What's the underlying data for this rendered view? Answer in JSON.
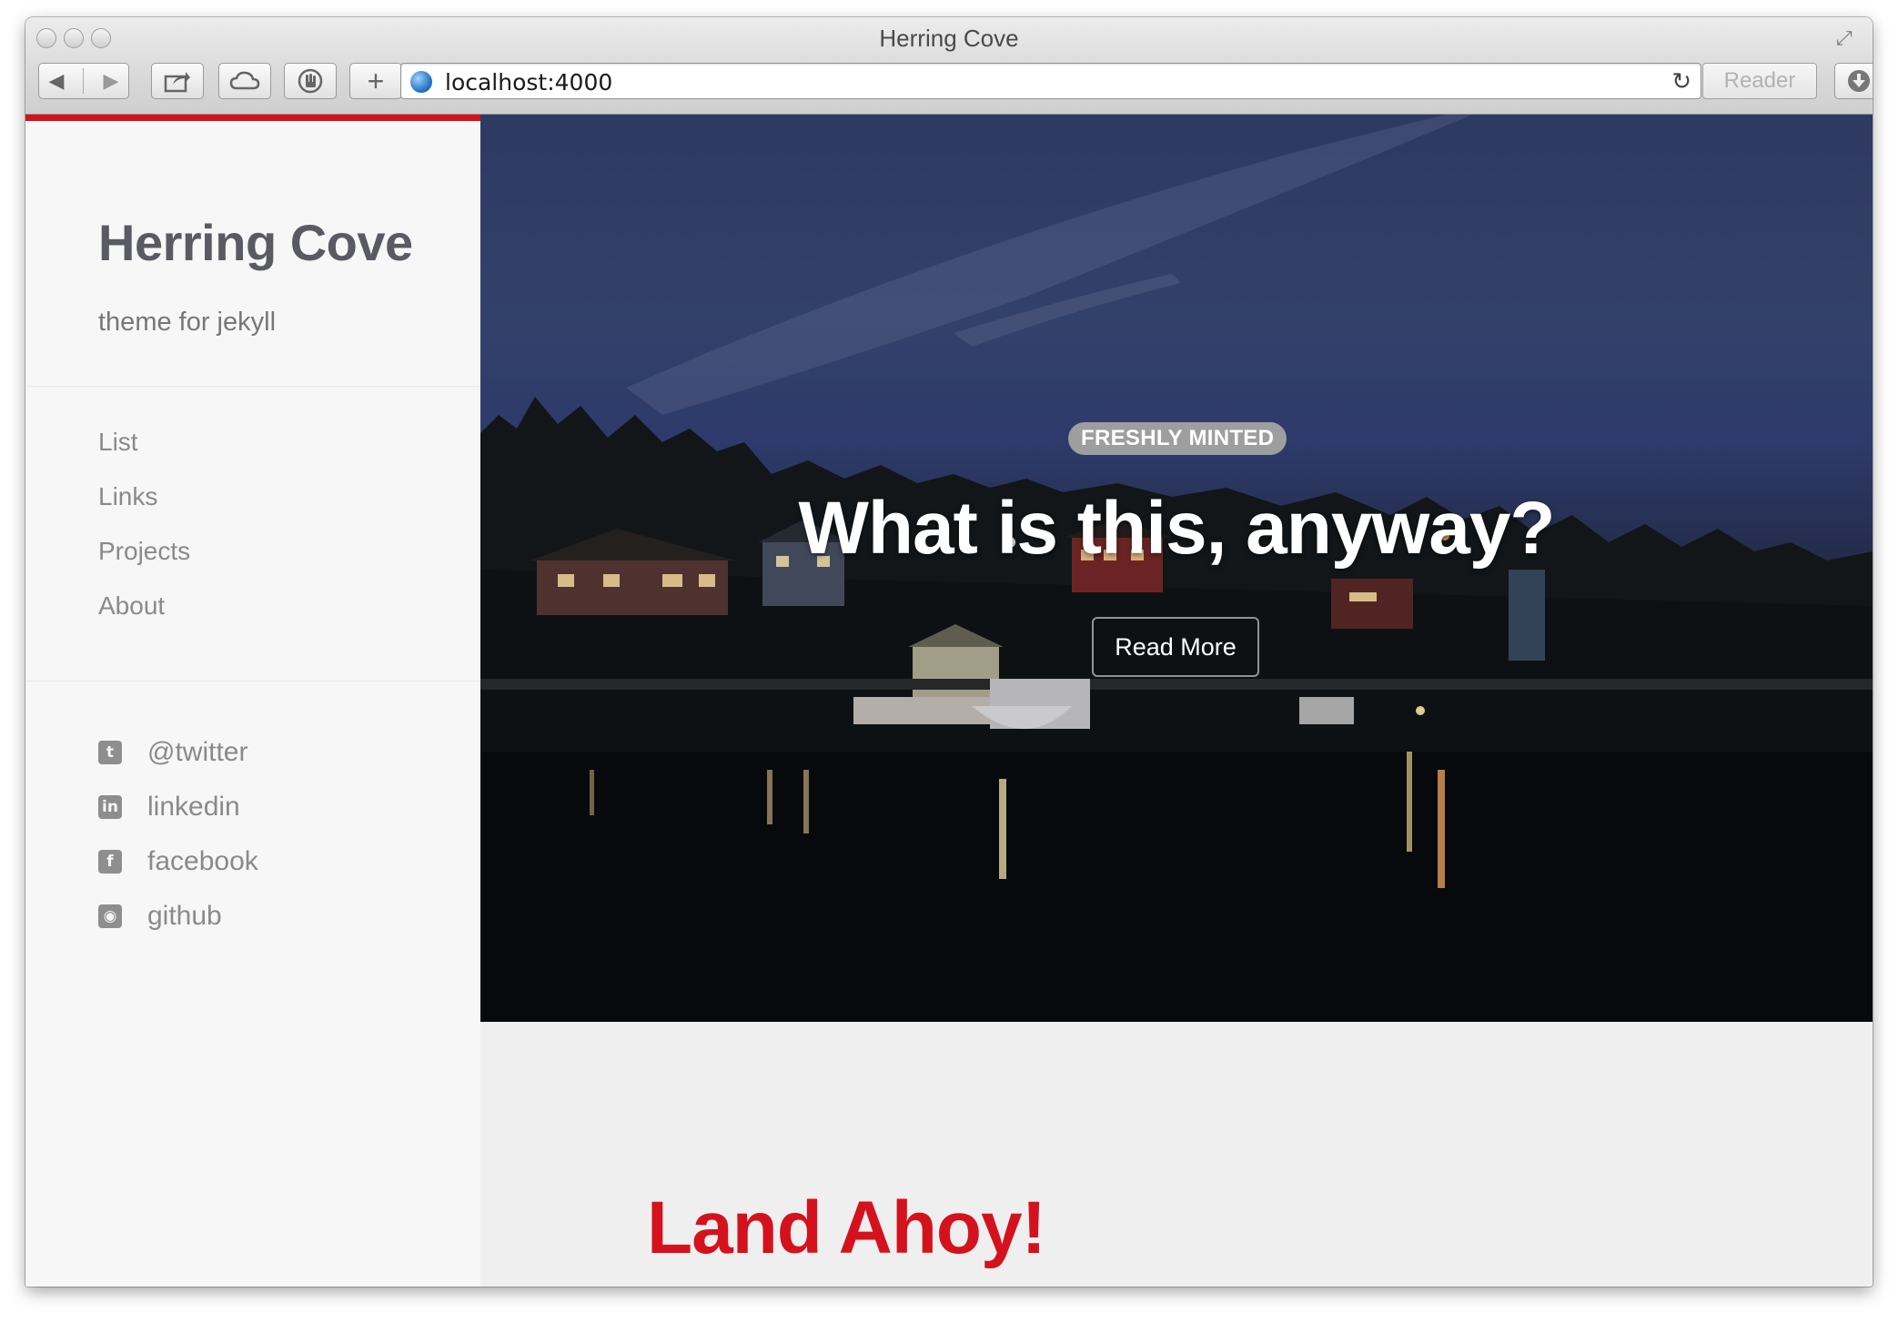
{
  "window": {
    "title": "Herring Cove"
  },
  "toolbar": {
    "url": "localhost:4000",
    "reader_label": "Reader"
  },
  "sidebar": {
    "site_title": "Herring Cove",
    "tagline": "theme for jekyll",
    "nav": [
      {
        "label": "List"
      },
      {
        "label": "Links"
      },
      {
        "label": "Projects"
      },
      {
        "label": "About"
      }
    ],
    "social": [
      {
        "label": "@twitter",
        "icon": "twitter-icon"
      },
      {
        "label": "linkedin",
        "icon": "linkedin-icon"
      },
      {
        "label": "facebook",
        "icon": "facebook-icon"
      },
      {
        "label": "github",
        "icon": "github-icon"
      }
    ]
  },
  "hero": {
    "badge": "FRESHLY MINTED",
    "title": "What is this, anyway?",
    "button": "Read More"
  },
  "posts": [
    {
      "title": "Land Ahoy!"
    }
  ],
  "colors": {
    "accent": "#d4121e",
    "sidebar_bg": "#f7f7f7",
    "content_bg": "#efefef"
  }
}
